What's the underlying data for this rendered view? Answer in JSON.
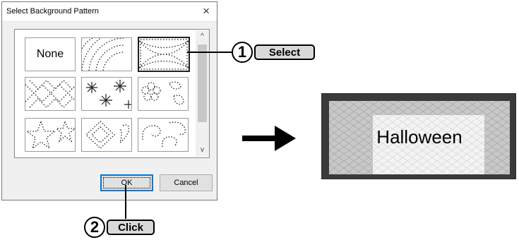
{
  "dialog": {
    "title": "Select Background Pattern",
    "close_glyph": "×",
    "patterns": [
      {
        "label": "None",
        "icon": "none-pattern"
      },
      {
        "icon": "rainbow-arcs-pattern"
      },
      {
        "icon": "diamond-lattice-pattern",
        "selected": true
      },
      {
        "icon": "zigzag-pattern"
      },
      {
        "icon": "snowflake-pattern"
      },
      {
        "icon": "flower-pattern"
      },
      {
        "icon": "star-pattern"
      },
      {
        "icon": "heart-diamond-pattern"
      },
      {
        "icon": "swirl-pattern"
      }
    ],
    "scroll_up_glyph": "^",
    "scroll_down_glyph": "v",
    "ok_label": "OK",
    "cancel_label": "Cancel"
  },
  "callouts": {
    "select": {
      "number": "1",
      "label": "Select"
    },
    "click": {
      "number": "2",
      "label": "Click"
    }
  },
  "result": {
    "text": "Halloween"
  },
  "colors": {
    "callout_fill": "#d9d9d9",
    "result_frame": "#3a3a3a",
    "ok_focus": "#0078d7"
  }
}
